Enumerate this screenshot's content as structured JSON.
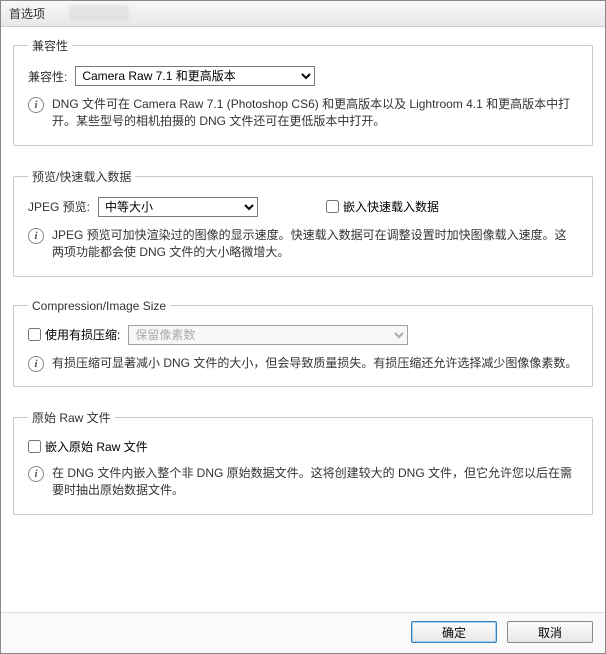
{
  "window": {
    "title": "首选项"
  },
  "groups": {
    "compat": {
      "legend": "兼容性",
      "label": "兼容性:",
      "selected": "Camera Raw 7.1 和更高版本",
      "info": "DNG 文件可在 Camera Raw 7.1 (Photoshop CS6) 和更高版本以及 Lightroom 4.1 和更高版本中打开。某些型号的相机拍摄的 DNG 文件还可在更低版本中打开。"
    },
    "preview": {
      "legend": "预览/快速载入数据",
      "label": "JPEG 预览:",
      "selected": "中等大小",
      "embedCheckbox": "嵌入快速载入数据",
      "info": "JPEG 预览可加快渲染过的图像的显示速度。快速载入数据可在调整设置时加快图像载入速度。这两项功能都会使 DNG 文件的大小略微增大。"
    },
    "compression": {
      "legend": "Compression/Image Size",
      "checkbox": "使用有损压缩:",
      "selected": "保留像素数",
      "info": "有损压缩可显著减小 DNG 文件的大小，但会导致质量损失。有损压缩还允许选择减少图像像素数。"
    },
    "raw": {
      "legend": "原始 Raw 文件",
      "checkbox": "嵌入原始 Raw 文件",
      "info": "在 DNG 文件内嵌入整个非 DNG 原始数据文件。这将创建较大的 DNG 文件，但它允许您以后在需要时抽出原始数据文件。"
    }
  },
  "buttons": {
    "ok": "确定",
    "cancel": "取消"
  }
}
